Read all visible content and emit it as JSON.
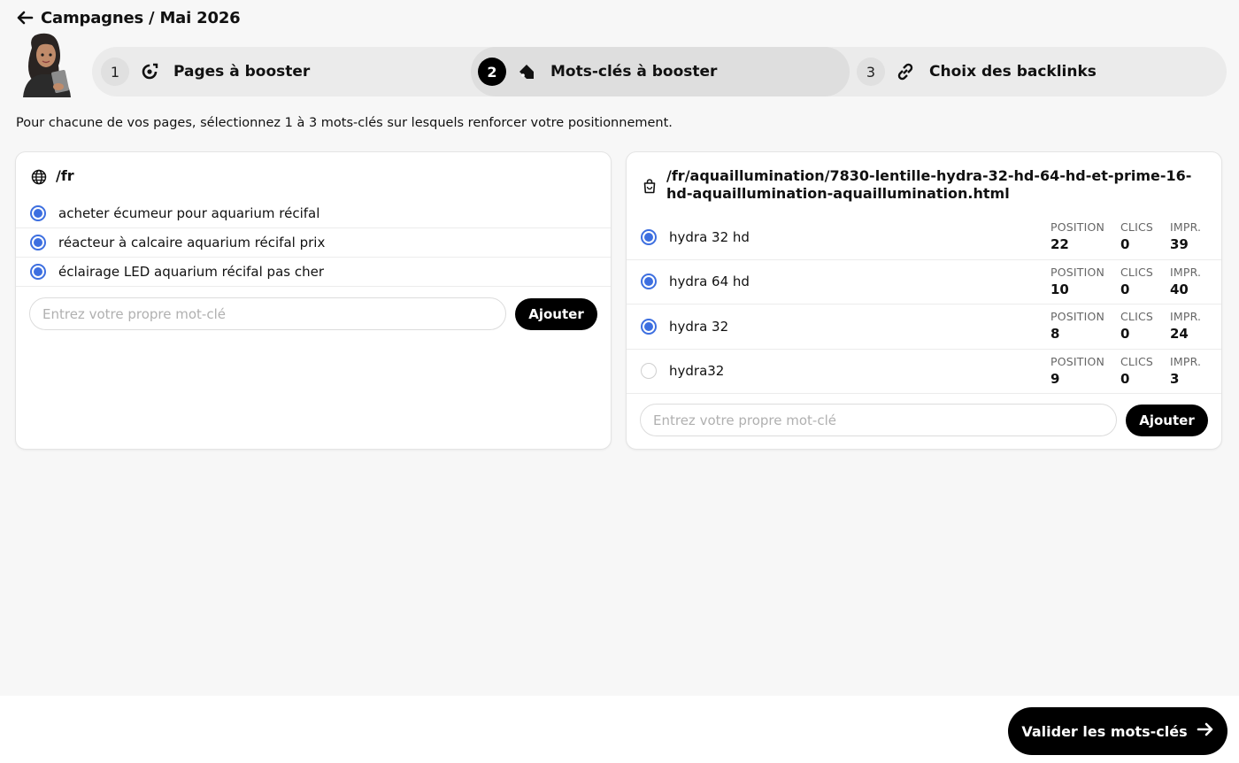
{
  "header": {
    "back_icon": "arrow-left-icon",
    "title": "Campagnes / Mai 2026"
  },
  "stepper": {
    "steps": [
      {
        "number": "1",
        "icon": "target-refresh-icon",
        "label": "Pages à booster",
        "active": false
      },
      {
        "number": "2",
        "icon": "tag-icon",
        "label": "Mots-clés à booster",
        "active": true
      },
      {
        "number": "3",
        "icon": "link-icon",
        "label": "Choix des backlinks",
        "active": false
      }
    ]
  },
  "intro": "Pour chacune de vos pages, sélectionnez 1 à 3 mots-clés sur lesquels renforcer votre positionnement.",
  "left_card": {
    "icon": "globe-icon",
    "title": "/fr",
    "keywords": [
      {
        "label": "acheter écumeur pour aquarium récifal",
        "selected": true
      },
      {
        "label": "réacteur à calcaire aquarium récifal prix",
        "selected": true
      },
      {
        "label": "éclairage LED aquarium récifal pas cher",
        "selected": true
      }
    ],
    "input_placeholder": "Entrez votre propre mot-clé",
    "add_label": "Ajouter"
  },
  "right_card": {
    "icon": "shopping-bag-icon",
    "title": "/fr/aquaillumination/7830-lentille-hydra-32-hd-64-hd-et-prime-16-hd-aquaillumination-aquaillumination.html",
    "stat_headers": {
      "position": "POSITION",
      "clicks": "CLICS",
      "impressions": "IMPR."
    },
    "keywords": [
      {
        "label": "hydra 32 hd",
        "selected": true,
        "position": "22",
        "clicks": "0",
        "impressions": "39"
      },
      {
        "label": "hydra 64 hd",
        "selected": true,
        "position": "10",
        "clicks": "0",
        "impressions": "40"
      },
      {
        "label": "hydra 32",
        "selected": true,
        "position": "8",
        "clicks": "0",
        "impressions": "24"
      },
      {
        "label": "hydra32",
        "selected": false,
        "position": "9",
        "clicks": "0",
        "impressions": "3"
      }
    ],
    "input_placeholder": "Entrez votre propre mot-clé",
    "add_label": "Ajouter"
  },
  "footer": {
    "submit_label": "Valider les mots-clés",
    "submit_icon": "arrow-right-icon"
  },
  "colors": {
    "accent": "#3d6fe0",
    "primary_button": "#000000",
    "stepper_bg": "#ebebeb"
  }
}
